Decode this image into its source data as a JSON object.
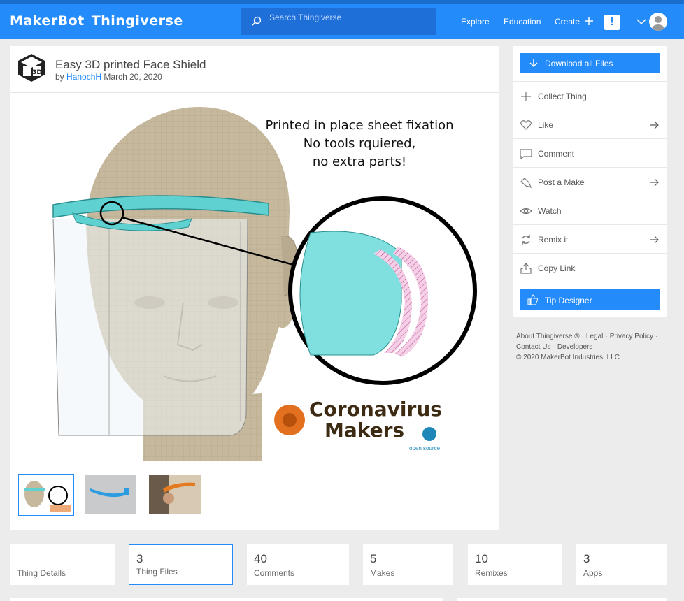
{
  "header": {
    "brand_left": "MakerBot",
    "brand_right": "Thingiverse",
    "search_placeholder": "Search Thingiverse",
    "nav": [
      "Explore",
      "Education",
      "Create"
    ],
    "alert": "!"
  },
  "thing": {
    "title": "Easy 3D printed Face Shield",
    "by_label": "by",
    "author": "HanochH",
    "date": "March 20, 2020",
    "hero_text": [
      "Printed in place sheet fixation",
      "No tools rquiered,",
      "no extra parts!"
    ],
    "hero_brand": [
      "Coronavirus",
      "Makers"
    ],
    "hero_brand_sub": "open source"
  },
  "sidebar": {
    "download": "Download all Files",
    "actions": [
      {
        "label": "Collect Thing",
        "icon": "plus-icon",
        "arrow": false
      },
      {
        "label": "Like",
        "icon": "heart-icon",
        "arrow": true
      },
      {
        "label": "Comment",
        "icon": "comment-icon",
        "arrow": false
      },
      {
        "label": "Post a Make",
        "icon": "hand-icon",
        "arrow": true
      },
      {
        "label": "Watch",
        "icon": "eye-icon",
        "arrow": false
      },
      {
        "label": "Remix it",
        "icon": "remix-icon",
        "arrow": true
      },
      {
        "label": "Copy Link",
        "icon": "share-icon",
        "arrow": false
      }
    ],
    "tip": "Tip Designer"
  },
  "footer": {
    "links": [
      "About Thingiverse ®",
      "Legal",
      "Privacy Policy",
      "Contact Us",
      "Developers"
    ],
    "copyright": "©  2020 MakerBot Industries, LLC"
  },
  "tabs": [
    {
      "count": "",
      "label": "Thing Details"
    },
    {
      "count": "3",
      "label": "Thing Files"
    },
    {
      "count": "40",
      "label": "Comments"
    },
    {
      "count": "5",
      "label": "Makes"
    },
    {
      "count": "10",
      "label": "Remixes"
    },
    {
      "count": "3",
      "label": "Apps"
    }
  ],
  "colors": {
    "accent": "#248bfb",
    "shield": "#5fd1d1",
    "head": "#c6b89c"
  }
}
